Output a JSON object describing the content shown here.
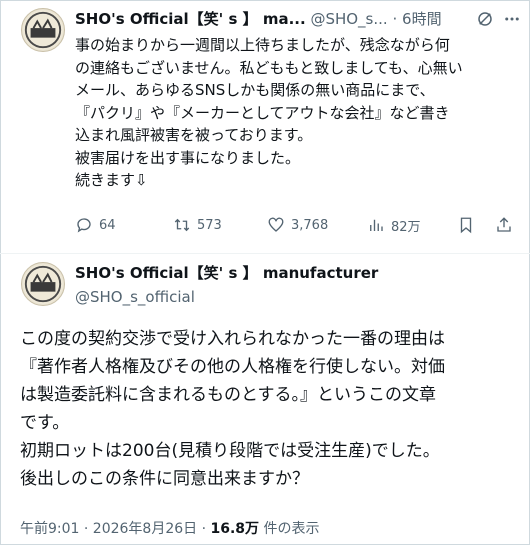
{
  "tweet1": {
    "display_name": "SHO's Official【笑' s 】 ma...",
    "handle": "@SHO_s...",
    "separator": "·",
    "time": "6時間",
    "text": "事の始まりから一週間以上待ちましたが、残念ながら何\nの連絡もございません。私どももと致しましても、心無い\nメール、あらゆるSNSしかも関係の無い商品にまで、\n『パクリ』や『メーカーとしてアウトな会社』など書き\n込まれ風評被害を被っております。\n被害届けを出す事になりました。\n続きます⇩",
    "actions": {
      "replies": "64",
      "reposts": "573",
      "likes": "3,768",
      "views": "82万"
    },
    "icons": [
      "grok-icon",
      "more-icon",
      "reply-icon",
      "repost-icon",
      "like-icon",
      "views-icon",
      "bookmark-icon",
      "share-icon"
    ]
  },
  "tweet2": {
    "display_name": "SHO's Official【笑' s 】 manufacturer",
    "handle": "@SHO_s_official",
    "text": "この度の契約交渉で受け入れられなかった一番の理由は\n『著作者人格権及びその他の人格権を行使しない。対価\nは製造委託料に含まれるものとする。』というこの文章\nです。\n初期ロットは200台(見積り段階では受注生産)でした。\n後出しのこの条件に同意出来ますか？",
    "timestamp": "午前9:01 · 2026年8月26日 · ",
    "view_count": "16.8万",
    "view_suffix": " 件の表示"
  },
  "colors": {
    "text": "#0f1419",
    "secondary": "#536471",
    "border": "#cfd9de"
  }
}
